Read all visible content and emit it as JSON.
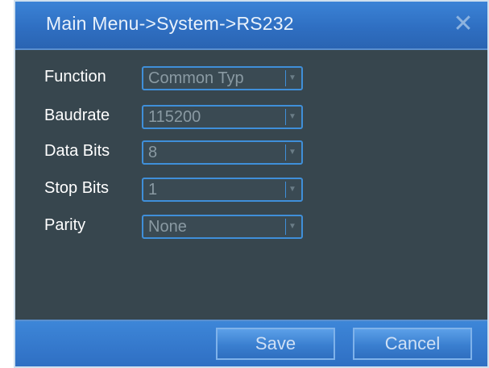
{
  "window": {
    "title": "Main Menu->System->RS232",
    "close_icon": "close-icon"
  },
  "form": {
    "fields": [
      {
        "label": "Function",
        "value": "Common Type",
        "display": "Common Typ"
      },
      {
        "label": "Baudrate",
        "value": "115200",
        "display": "115200"
      },
      {
        "label": "Data Bits",
        "value": "8",
        "display": "8"
      },
      {
        "label": "Stop Bits",
        "value": "1",
        "display": "1"
      },
      {
        "label": "Parity",
        "value": "None",
        "display": "None"
      }
    ]
  },
  "footer": {
    "save_label": "Save",
    "cancel_label": "Cancel"
  },
  "colors": {
    "titlebar": "#2f6fc2",
    "body": "#37464e",
    "field_border": "#3f8fd9",
    "label_text": "#ffffff",
    "value_text": "#8a9aa3"
  }
}
